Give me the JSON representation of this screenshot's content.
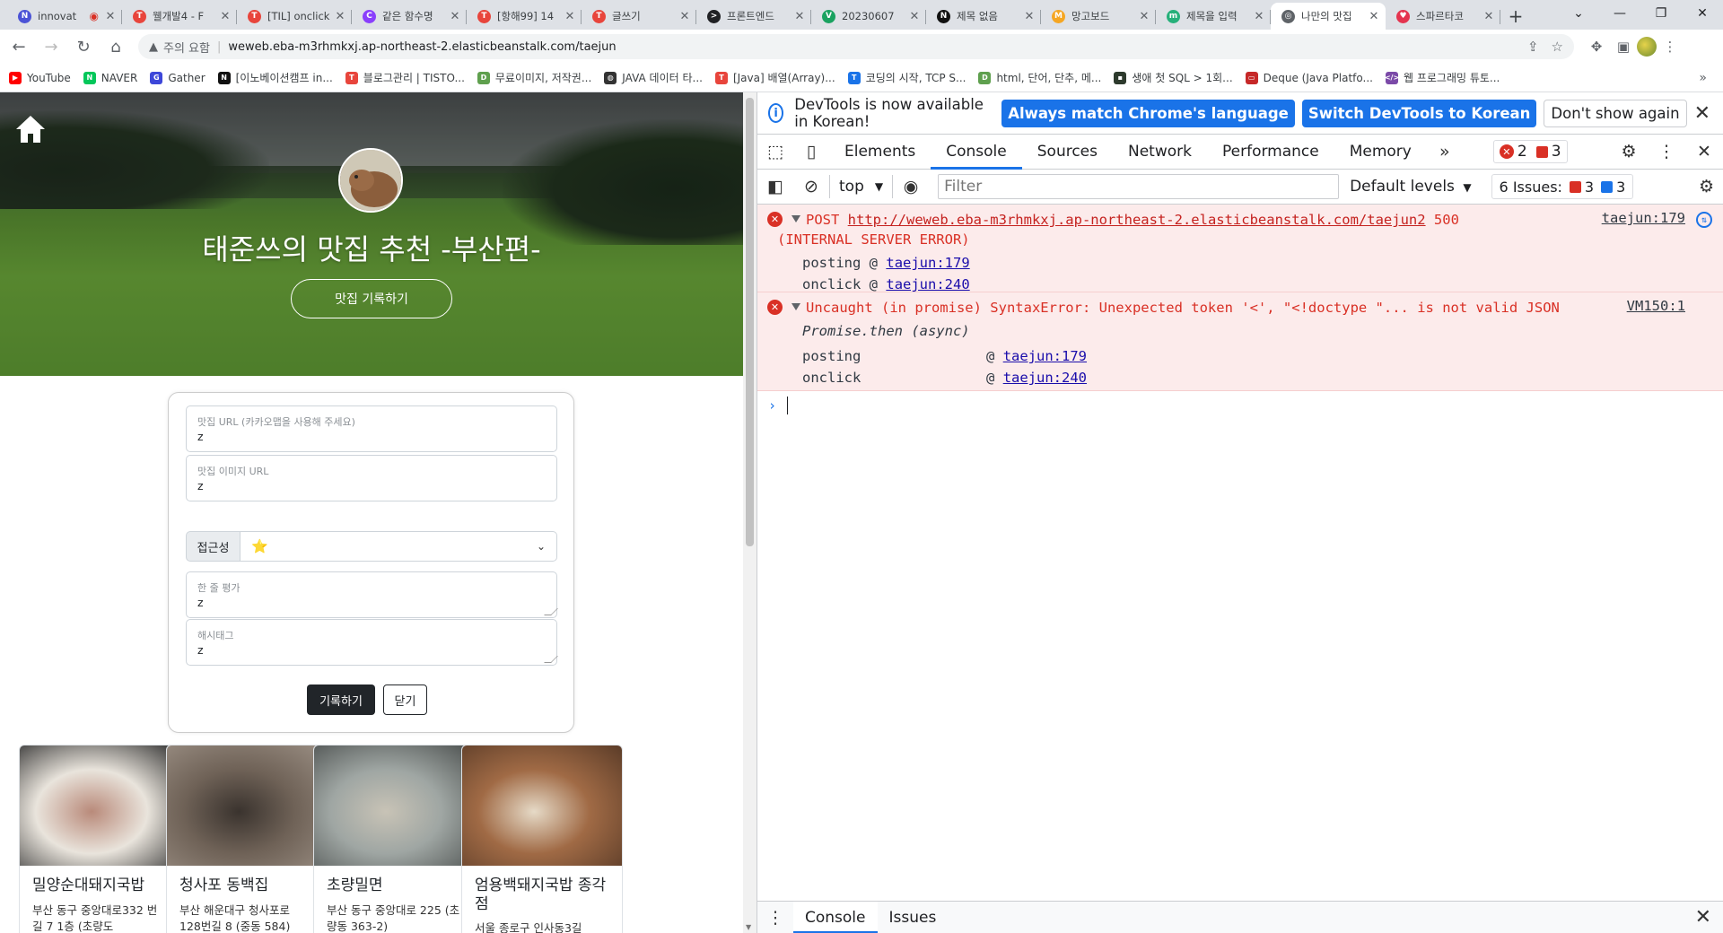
{
  "browser": {
    "tabs": [
      {
        "title": "innovat",
        "favicon_color": "#4b53d6",
        "favicon_letter": "N",
        "recording": true
      },
      {
        "title": "웰개발4 - F",
        "favicon_color": "#e8453c",
        "favicon_letter": "T"
      },
      {
        "title": "[TIL] onclick",
        "favicon_color": "#e8453c",
        "favicon_letter": "T"
      },
      {
        "title": "같은 함수명",
        "favicon_color": "#8a3ffc",
        "favicon_letter": "C"
      },
      {
        "title": "[항해99] 14",
        "favicon_color": "#e8453c",
        "favicon_letter": "T"
      },
      {
        "title": "글쓰기",
        "favicon_color": "#e8453c",
        "favicon_letter": "T"
      },
      {
        "title": "프론트엔드",
        "favicon_color": "#202124",
        "favicon_letter": ">"
      },
      {
        "title": "20230607",
        "favicon_color": "#1aa260",
        "favicon_letter": "V"
      },
      {
        "title": "제목 없음",
        "favicon_color": "#111111",
        "favicon_letter": "N"
      },
      {
        "title": "망고보드",
        "favicon_color": "#f5a623",
        "favicon_letter": "M"
      },
      {
        "title": "제목을 입력",
        "favicon_color": "#26b07a",
        "favicon_letter": "m"
      },
      {
        "title": "나만의 맛집",
        "favicon_color": "#5f6368",
        "favicon_letter": "◎",
        "active": true
      },
      {
        "title": "스파르타코",
        "favicon_color": "#e4344f",
        "favicon_letter": "♥"
      }
    ],
    "security_label": "주의 요함",
    "url": "weweb.eba-m3rhmkxj.ap-northeast-2.elasticbeanstalk.com/taejun",
    "bookmarks": [
      {
        "label": "YouTube",
        "color": "#ff0000",
        "letter": "▶"
      },
      {
        "label": "NAVER",
        "color": "#03c75a",
        "letter": "N"
      },
      {
        "label": "Gather",
        "color": "#3d47d9",
        "letter": "G"
      },
      {
        "label": "[이노베이션캠프 in...",
        "color": "#111111",
        "letter": "N"
      },
      {
        "label": "블로그관리 | TISTO...",
        "color": "#e8453c",
        "letter": "T"
      },
      {
        "label": "무료이미지, 저작권...",
        "color": "#5fa04e",
        "letter": "D"
      },
      {
        "label": "JAVA 데이터 타...",
        "color": "#333333",
        "letter": "◍"
      },
      {
        "label": "[Java] 배열(Array)...",
        "color": "#e8453c",
        "letter": "T"
      },
      {
        "label": "코딩의 시작, TCP S...",
        "color": "#1a73e8",
        "letter": "T"
      },
      {
        "label": "html, 단어, 단추, 메...",
        "color": "#5fa04e",
        "letter": "D"
      },
      {
        "label": "생애 첫 SQL > 1회...",
        "color": "#2d3a2d",
        "letter": "▪"
      },
      {
        "label": "Deque (Java Platfo...",
        "color": "#c62828",
        "letter": "▭"
      },
      {
        "label": "웹 프로그래밍 튜토...",
        "color": "#7b4aa8",
        "letter": "</>"
      }
    ],
    "bookmarks_more": "»"
  },
  "page": {
    "title": "태준쓰의 맛집 추천 -부산편-",
    "record_open_label": "맛집 기록하기",
    "form": {
      "url_label": "맛집 URL (카카오맵을 사용해 주세요)",
      "url_value": "z",
      "image_label": "맛집 이미지 URL",
      "image_value": "z",
      "access_label": "접근성",
      "access_value": "⭐",
      "comment_label": "한 줄 평가",
      "comment_value": "z",
      "hashtag_label": "해시태그",
      "hashtag_value": "z",
      "submit_label": "기록하기",
      "close_label": "닫기"
    },
    "cards": [
      {
        "title": "밀양순대돼지국밥",
        "address": "부산 동구 중앙대로332 번길 7 1층 (초량도",
        "image_colors": [
          "#e9e4dc",
          "#b98a7a",
          "#2c2c2c"
        ]
      },
      {
        "title": "청사포 동백집",
        "address": "부산 해운대구 청사포로 128번길 8 (중동 584)",
        "image_colors": [
          "#6f6257",
          "#3a332e",
          "#9b8f84"
        ]
      },
      {
        "title": "초량밀면",
        "address": "부산 동구 중앙대로 225 (초량동 363-2)",
        "image_colors": [
          "#9fa6a3",
          "#c8c3b6",
          "#4b4f4e"
        ]
      },
      {
        "title": "엄용백돼지국밥 종각점",
        "address": "서울 종로구 인사동3길",
        "image_colors": [
          "#a06a45",
          "#e6dac7",
          "#5b3c28"
        ]
      }
    ]
  },
  "devtools": {
    "infobar": {
      "message": "DevTools is now available in Korean!",
      "btn_match": "Always match Chrome's language",
      "btn_switch": "Switch DevTools to Korean",
      "btn_dismiss": "Don't show again"
    },
    "tabs": [
      "Elements",
      "Console",
      "Sources",
      "Network",
      "Performance",
      "Memory"
    ],
    "active_tab": "Console",
    "more_tabs": "»",
    "error_count": "2",
    "warning_count": "3",
    "console_toolbar": {
      "context": "top",
      "filter_placeholder": "Filter",
      "levels": "Default levels",
      "issues_label": "6 Issues:",
      "issues_red": "3",
      "issues_blue": "3"
    },
    "messages": [
      {
        "method": "POST",
        "url": "http://weweb.eba-m3rhmkxj.ap-northeast-2.elasticbeanstalk.com/taejun2",
        "status": "500",
        "status_text": "(INTERNAL SERVER ERROR)",
        "source": "taejun:179",
        "stack": [
          {
            "fn": "posting",
            "at": "@",
            "loc": "taejun:179"
          },
          {
            "fn": "onclick",
            "at": "@",
            "loc": "taejun:240"
          }
        ]
      },
      {
        "text": "Uncaught (in promise) SyntaxError: Unexpected token '<', \"<!doctype \"... is not valid JSON",
        "source": "VM150:1",
        "async_label": "Promise.then (async)",
        "stack": [
          {
            "fn": "posting",
            "at": "@",
            "loc": "taejun:179"
          },
          {
            "fn": "onclick",
            "at": "@",
            "loc": "taejun:240"
          }
        ]
      }
    ],
    "prompt": "›",
    "drawer_tabs": [
      "Console",
      "Issues"
    ]
  }
}
